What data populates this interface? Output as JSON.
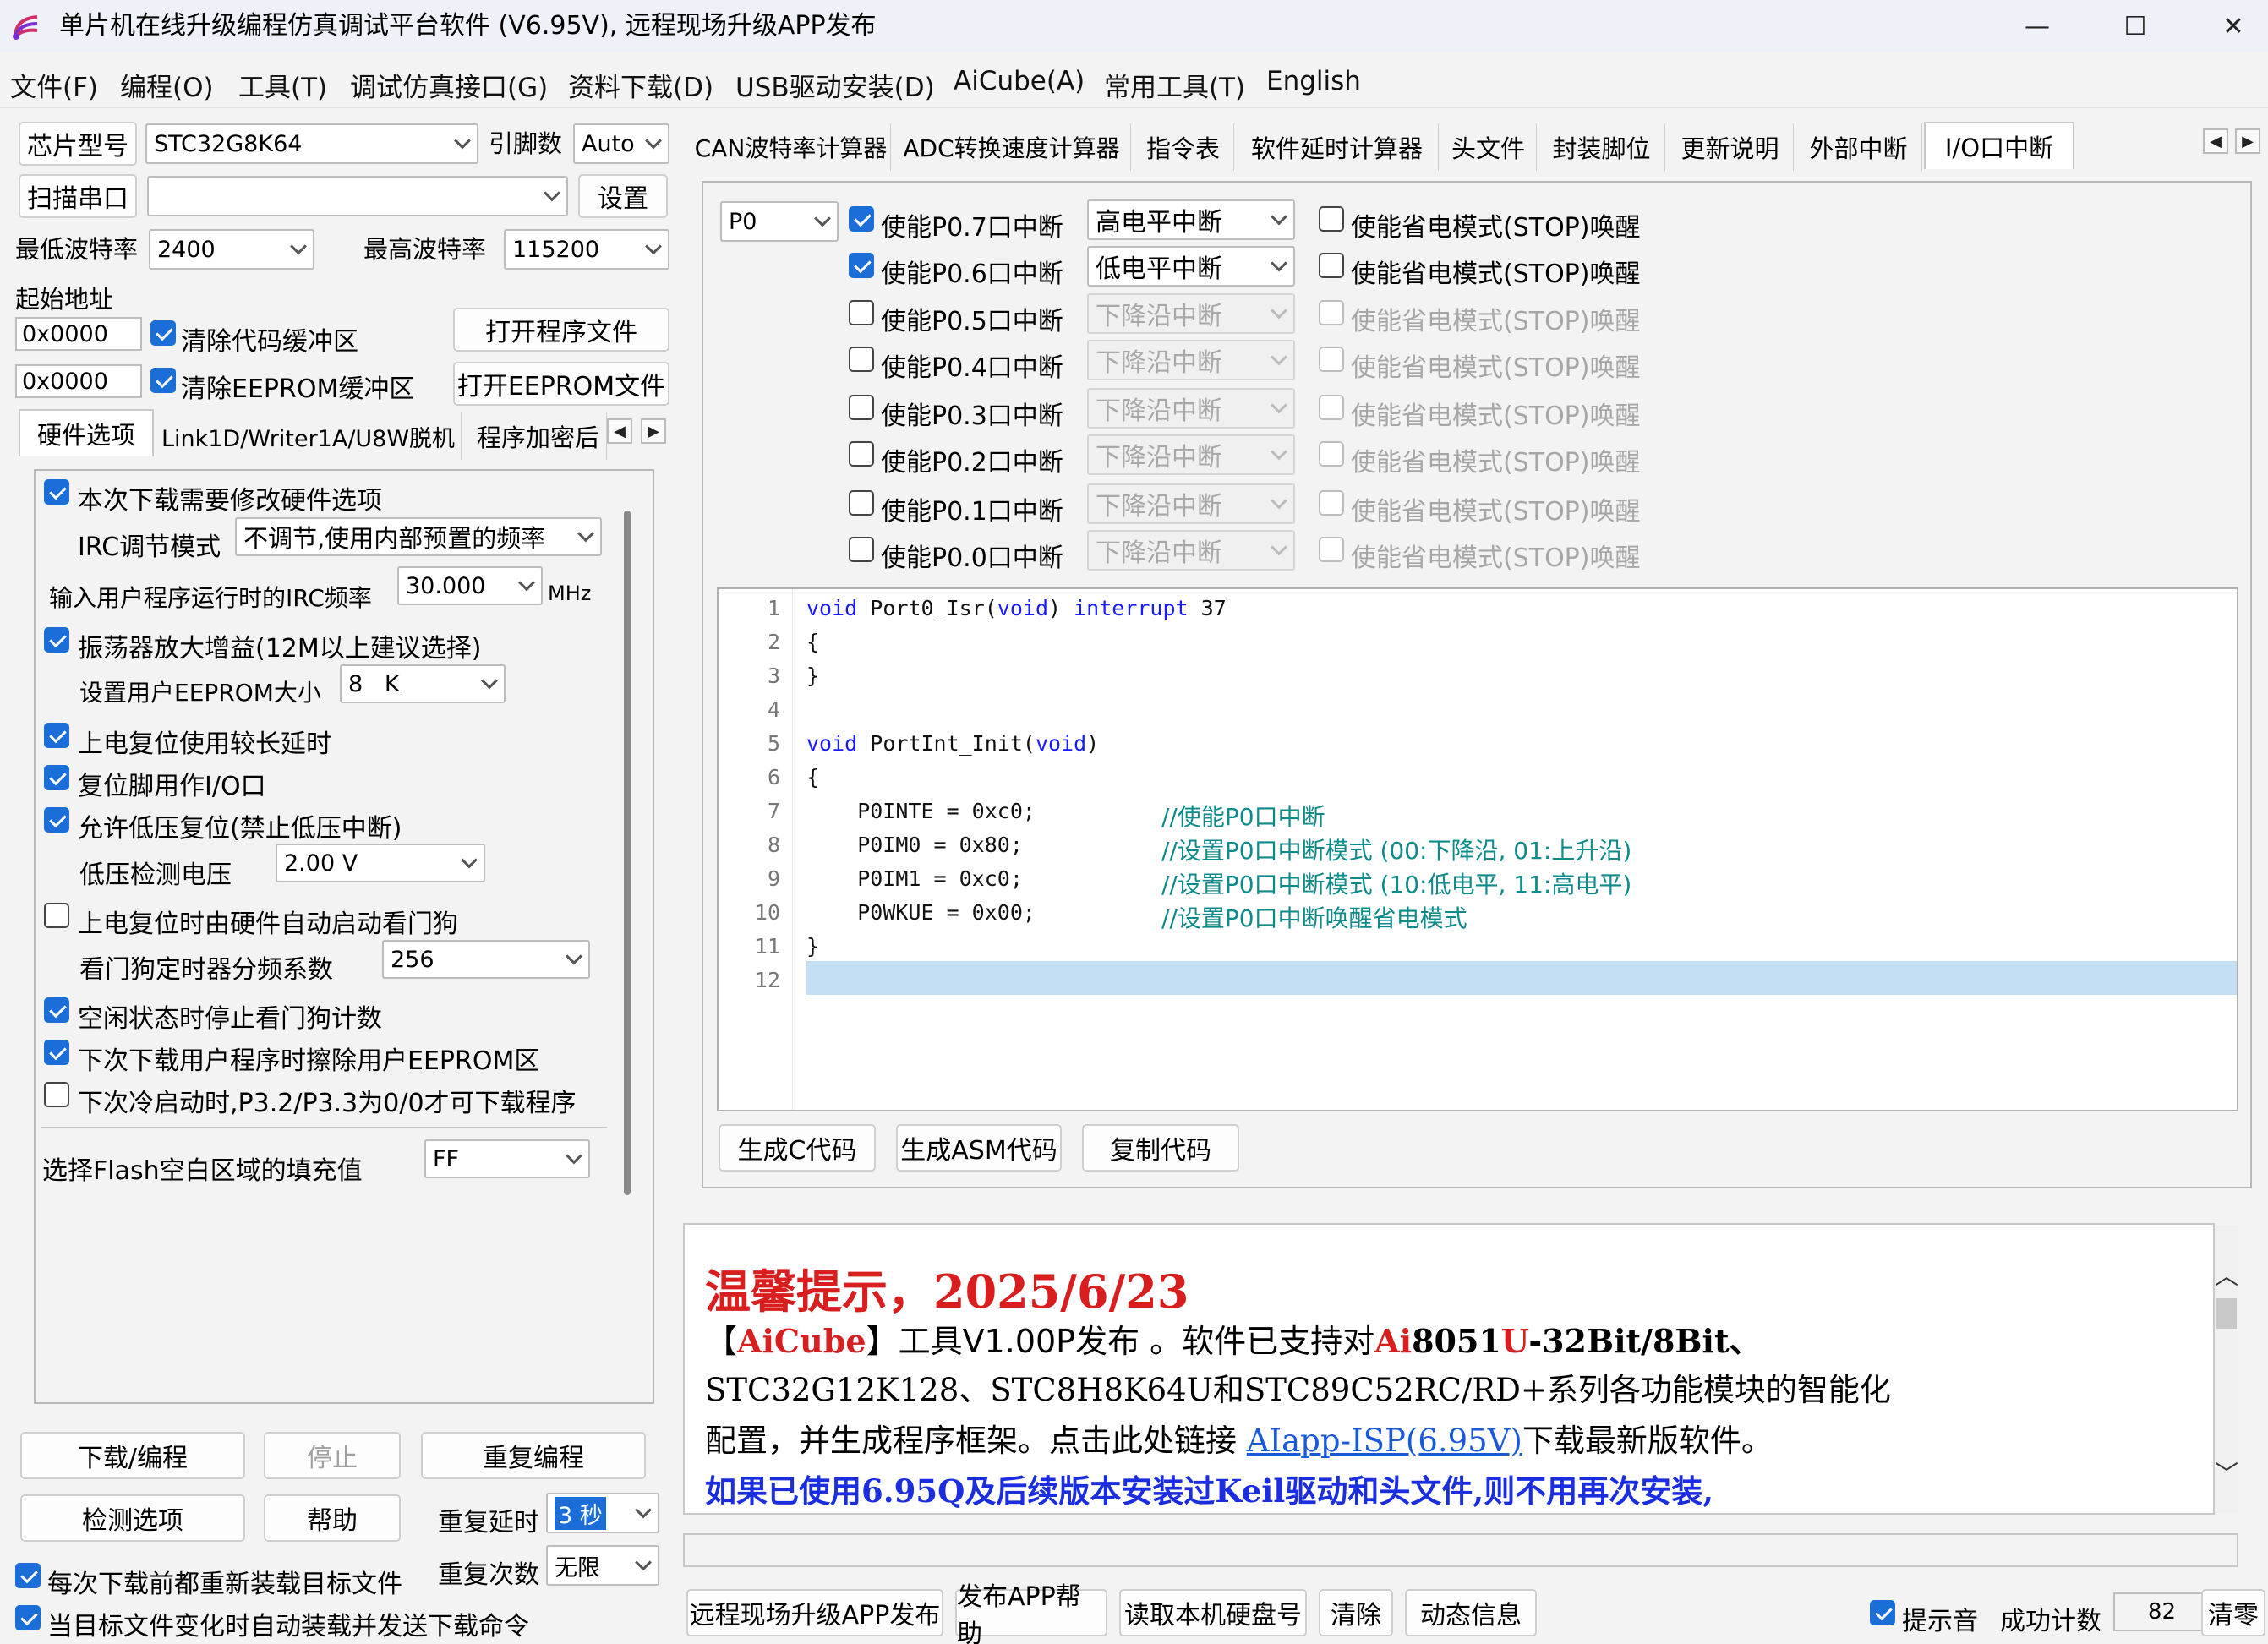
{
  "window": {
    "title": "单片机在线升级编程仿真调试平台软件 (V6.95V), 远程现场升级APP发布",
    "minimize": "—",
    "maximize": "☐",
    "close": "✕"
  },
  "menu": [
    "文件(F)",
    "编程(O)",
    "工具(T)",
    "调试仿真接口(G)",
    "资料下载(D)",
    "USB驱动安装(D)",
    "AiCube(A)",
    "常用工具(T)",
    "English"
  ],
  "left": {
    "chip_label": "芯片型号",
    "chip_value": "STC32G8K64",
    "pin_label": "引脚数",
    "pin_value": "Auto",
    "scan_button": "扫描串口",
    "port_value": "",
    "settings_button": "设置",
    "min_baud_label": "最低波特率",
    "min_baud_value": "2400",
    "max_baud_label": "最高波特率",
    "max_baud_value": "115200",
    "start_addr_label": "起始地址",
    "addr1": "0x0000",
    "addr2": "0x0000",
    "clear_code": "清除代码缓冲区",
    "clear_eeprom": "清除EEPROM缓冲区",
    "open_program": "打开程序文件",
    "open_eeprom": "打开EEPROM文件",
    "tabs": [
      "硬件选项",
      "Link1D/Writer1A/U8W脱机",
      "程序加密后"
    ],
    "hw": {
      "modify_hw": "本次下载需要修改硬件选项",
      "irc_mode_label": "IRC调节模式",
      "irc_mode_value": "不调节,使用内部预置的频率",
      "irc_freq_label": "输入用户程序运行时的IRC频率",
      "irc_freq_value": "30.000",
      "irc_unit": "MHz",
      "osc_gain": "振荡器放大增益(12M以上建议选择)",
      "eeprom_size_label": "设置用户EEPROM大小",
      "eeprom_size_value": "8   K",
      "long_delay": "上电复位使用较长延时",
      "reset_pin_io": "复位脚用作I/O口",
      "low_volt_reset": "允许低压复位(禁止低压中断)",
      "low_volt_label": "低压检测电压",
      "low_volt_value": "2.00 V",
      "wdt_auto": "上电复位时由硬件自动启动看门狗",
      "wdt_div_label": "看门狗定时器分频系数",
      "wdt_div_value": "256",
      "idle_wdt": "空闲状态时停止看门狗计数",
      "erase_eeprom": "下次下载用户程序时擦除用户EEPROM区",
      "p32_p33": "下次冷启动时,P3.2/P3.3为0/0才可下载程序",
      "flash_fill_label": "选择Flash空白区域的填充值",
      "flash_fill_value": "FF"
    },
    "download_button": "下载/编程",
    "stop_button": "停止",
    "reprogram_button": "重复编程",
    "check_button": "检测选项",
    "help_button": "帮助",
    "repeat_delay_label": "重复延时",
    "repeat_delay_value": "3 秒",
    "repeat_count_label": "重复次数",
    "repeat_count_value": "无限",
    "reload_before": "每次下载前都重新装载目标文件",
    "auto_reload": "当目标文件变化时自动装载并发送下载命令"
  },
  "right": {
    "tabs": [
      "CAN波特率计算器",
      "ADC转换速度计算器",
      "指令表",
      "软件延时计算器",
      "头文件",
      "封装脚位",
      "更新说明",
      "外部中断",
      "I/O口中断"
    ],
    "port_value": "P0",
    "rows": [
      {
        "enable": "使能P0.7口中断",
        "mode": "高电平中断",
        "wake": "使能省电模式(STOP)唤醒"
      },
      {
        "enable": "使能P0.6口中断",
        "mode": "低电平中断",
        "wake": "使能省电模式(STOP)唤醒"
      },
      {
        "enable": "使能P0.5口中断",
        "mode": "下降沿中断",
        "wake": "使能省电模式(STOP)唤醒"
      },
      {
        "enable": "使能P0.4口中断",
        "mode": "下降沿中断",
        "wake": "使能省电模式(STOP)唤醒"
      },
      {
        "enable": "使能P0.3口中断",
        "mode": "下降沿中断",
        "wake": "使能省电模式(STOP)唤醒"
      },
      {
        "enable": "使能P0.2口中断",
        "mode": "下降沿中断",
        "wake": "使能省电模式(STOP)唤醒"
      },
      {
        "enable": "使能P0.1口中断",
        "mode": "下降沿中断",
        "wake": "使能省电模式(STOP)唤醒"
      },
      {
        "enable": "使能P0.0口中断",
        "mode": "下降沿中断",
        "wake": "使能省电模式(STOP)唤醒"
      }
    ],
    "code": {
      "line_numbers": [
        "1",
        "2",
        "3",
        "4",
        "5",
        "6",
        "7",
        "8",
        "9",
        "10",
        "11",
        "12"
      ],
      "l1_kw": "void",
      "l1_name": " Port0_Isr(",
      "l1_arg": "void",
      "l1_close": ") ",
      "l1_int": "interrupt",
      "l1_num": " 37",
      "l2": "{",
      "l3": "}",
      "l5_kw": "void",
      "l5_name": " PortInt_Init(",
      "l5_arg": "void",
      "l5_close": ")",
      "l6": "{",
      "l7_code": "    P0INTE = 0xc0;",
      "l7_cm": "//使能P0口中断",
      "l8_code": "    P0IM0 = 0x80;",
      "l8_cm": "//设置P0口中断模式 (00:下降沿, 01:上升沿)",
      "l9_code": "    P0IM1 = 0xc0;",
      "l9_cm": "//设置P0口中断模式 (10:低电平, 11:高电平)",
      "l10_code": "    P0WKUE = 0x00;",
      "l10_cm": "//设置P0口中断唤醒省电模式",
      "l11": "}"
    },
    "gen_c": "生成C代码",
    "gen_asm": "生成ASM代码",
    "copy_code": "复制代码"
  },
  "notice": {
    "title": "温馨提示，2025/6/23",
    "l1_a": "【",
    "l1_b": "AiCube",
    "l1_c": "】工具V1.00P发布 。软件已支持对",
    "l1_d": "Ai",
    "l1_e": "8051",
    "l1_f": "U",
    "l1_g": "-32Bit/8Bit、",
    "l2": "STC32G12K128、STC8H8K64U和STC89C52RC/RD+系列各功能模块的智能化",
    "l3_a": "配置，并生成程序框架。点击此处链接 ",
    "l3_link": "AIapp-ISP(6.95V)",
    "l3_b": "下载最新版软件。",
    "l4": "如果已使用6.95Q及后续版本安装过Keil驱动和头文件,则不用再次安装,"
  },
  "bottom": {
    "remote_app": "远程现场升级APP发布",
    "app_help": "发布APP帮助",
    "read_disk": "读取本机硬盘号",
    "clear": "清除",
    "dynamic": "动态信息",
    "beep": "提示音",
    "success_label": "成功计数",
    "success_value": "82",
    "reset_count": "清零"
  },
  "colors": {
    "accent": "#1b6ed8",
    "notice_red": "#d81e1e",
    "notice_blue": "#1a2ee0",
    "code_highlight": "#c4def3"
  }
}
